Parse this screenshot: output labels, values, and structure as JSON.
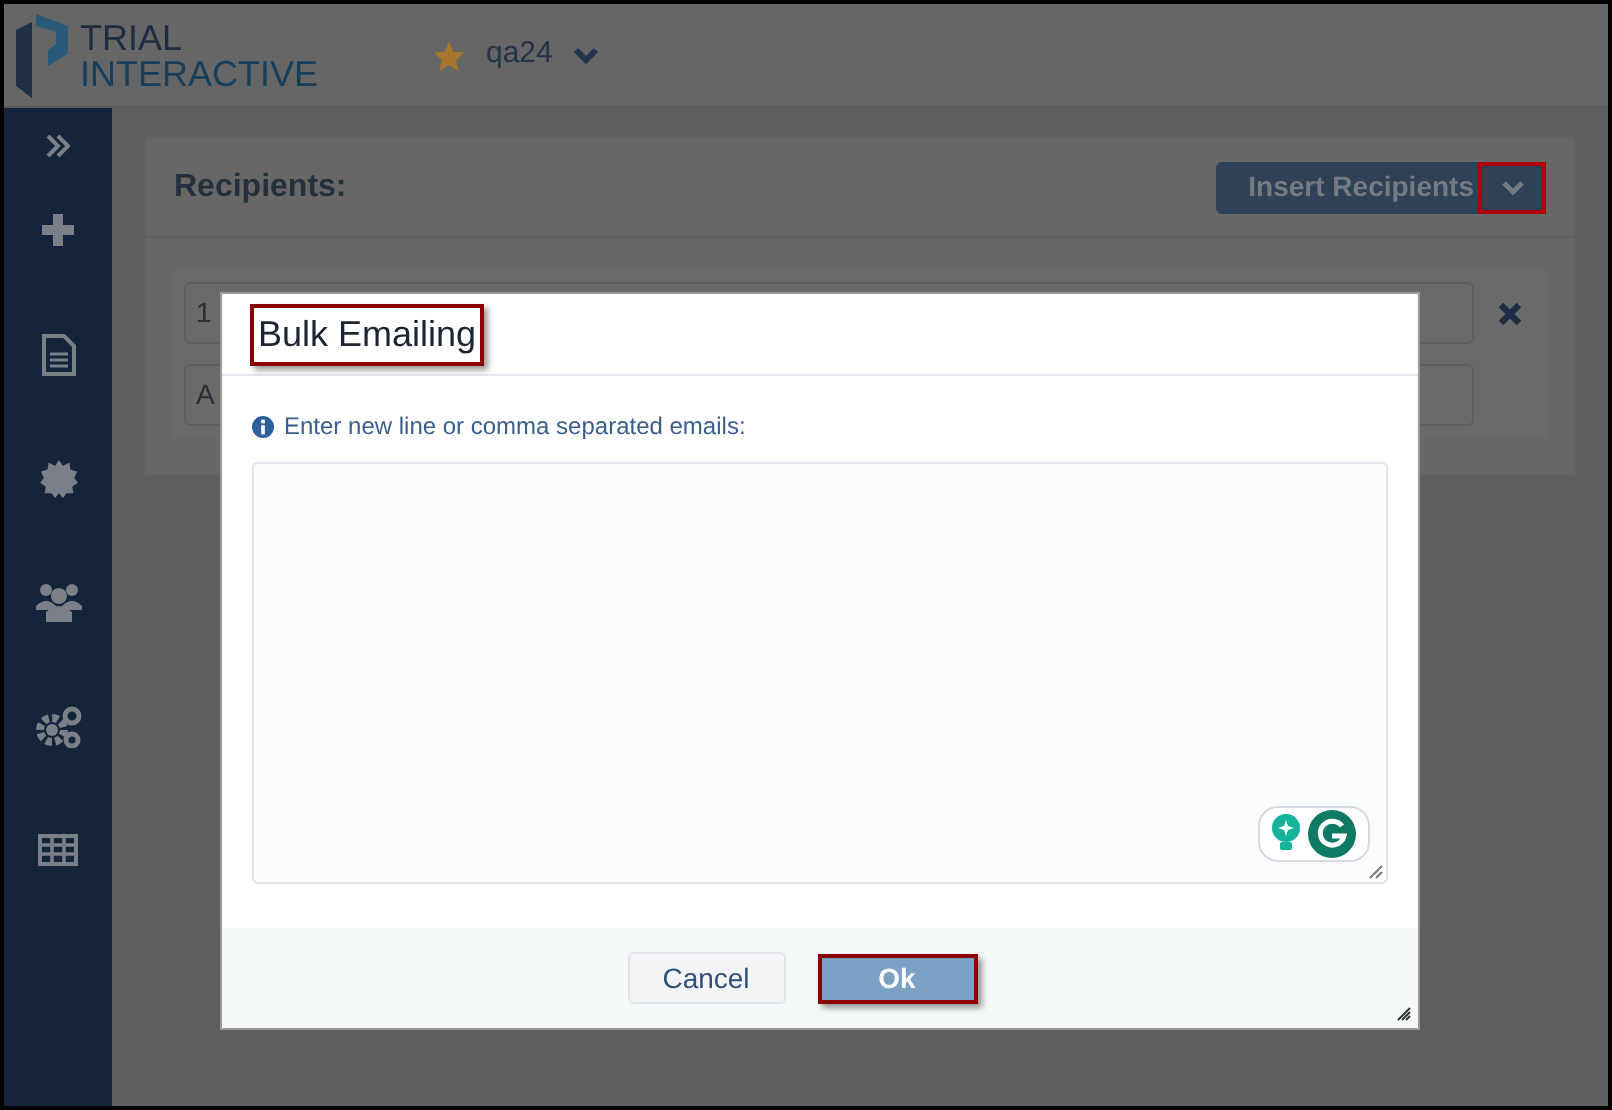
{
  "header": {
    "logo_top": "TRIAL",
    "logo_bottom": "INTERACTIVE",
    "favorite": true,
    "project": "qa24"
  },
  "sidebar": {
    "items": [
      {
        "kind": "expand"
      },
      {
        "kind": "plus"
      },
      {
        "kind": "document"
      },
      {
        "kind": "badge"
      },
      {
        "kind": "users"
      },
      {
        "kind": "gears"
      },
      {
        "kind": "table"
      }
    ]
  },
  "recipients": {
    "title": "Recipients:",
    "insert_button": "Insert Recipients",
    "dropdown_highlighted": true,
    "fields": [
      {
        "value": "1",
        "removable": true
      },
      {
        "value": "A",
        "removable": false
      }
    ]
  },
  "dialog": {
    "title": "Bulk Emailing",
    "title_highlighted": true,
    "hint": "Enter new line or comma separated emails:",
    "buttons": [
      {
        "label": "Cancel",
        "kind": "default",
        "highlighted": false
      },
      {
        "label": "Ok",
        "kind": "primary",
        "highlighted": true
      }
    ]
  }
}
